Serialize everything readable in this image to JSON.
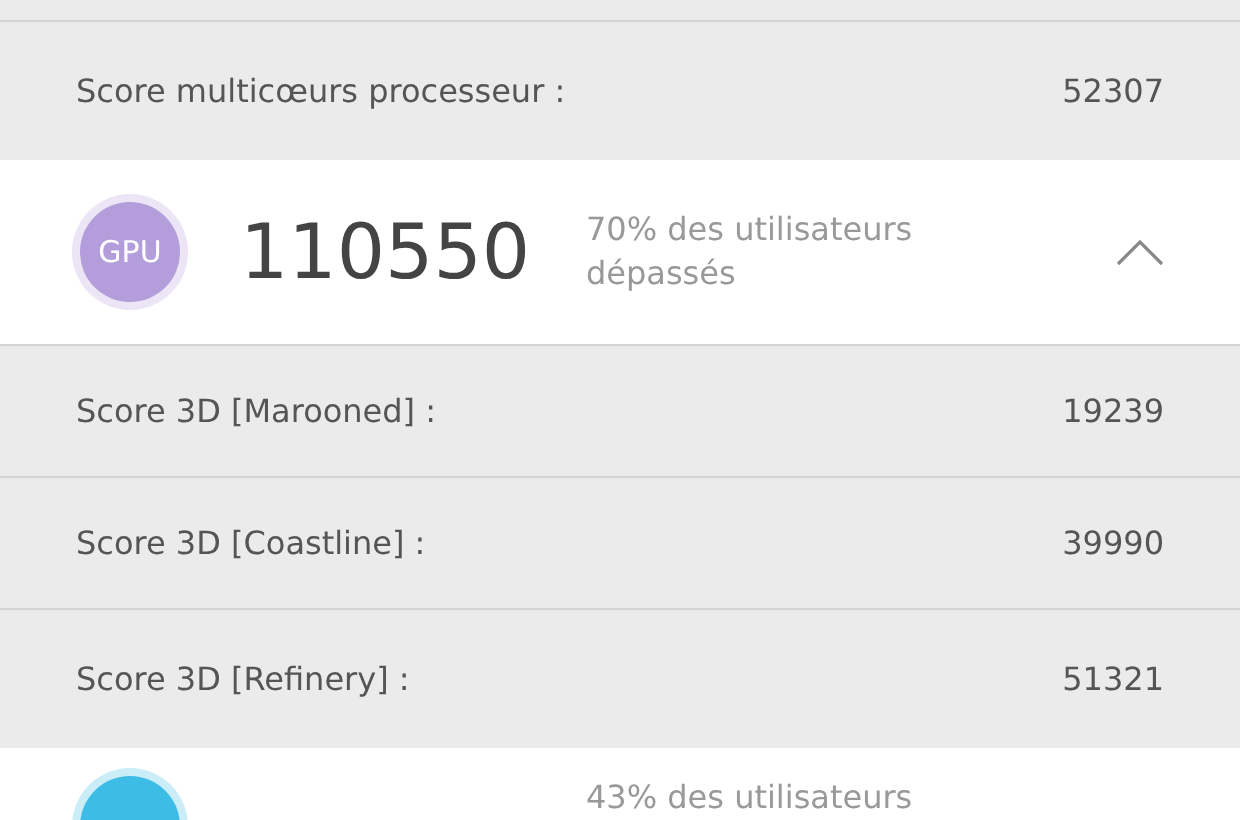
{
  "rows_above": [
    {
      "label": "Score multicœurs processeur :",
      "value": "52307"
    }
  ],
  "sections": [
    {
      "badge": "GPU",
      "color": "#b39ddb",
      "score": "110550",
      "percentile": [
        "70% des utilisateurs",
        "dépassés"
      ],
      "expanded": true,
      "rows": [
        {
          "label": "Score 3D [Marooned] :",
          "value": "19239"
        },
        {
          "label": "Score 3D [Coastline] :",
          "value": "39990"
        },
        {
          "label": "Score 3D [Refinery] :",
          "value": "51321"
        }
      ]
    },
    {
      "color": "#3dbde6",
      "percentile": [
        "43% des utilisateurs"
      ]
    }
  ]
}
